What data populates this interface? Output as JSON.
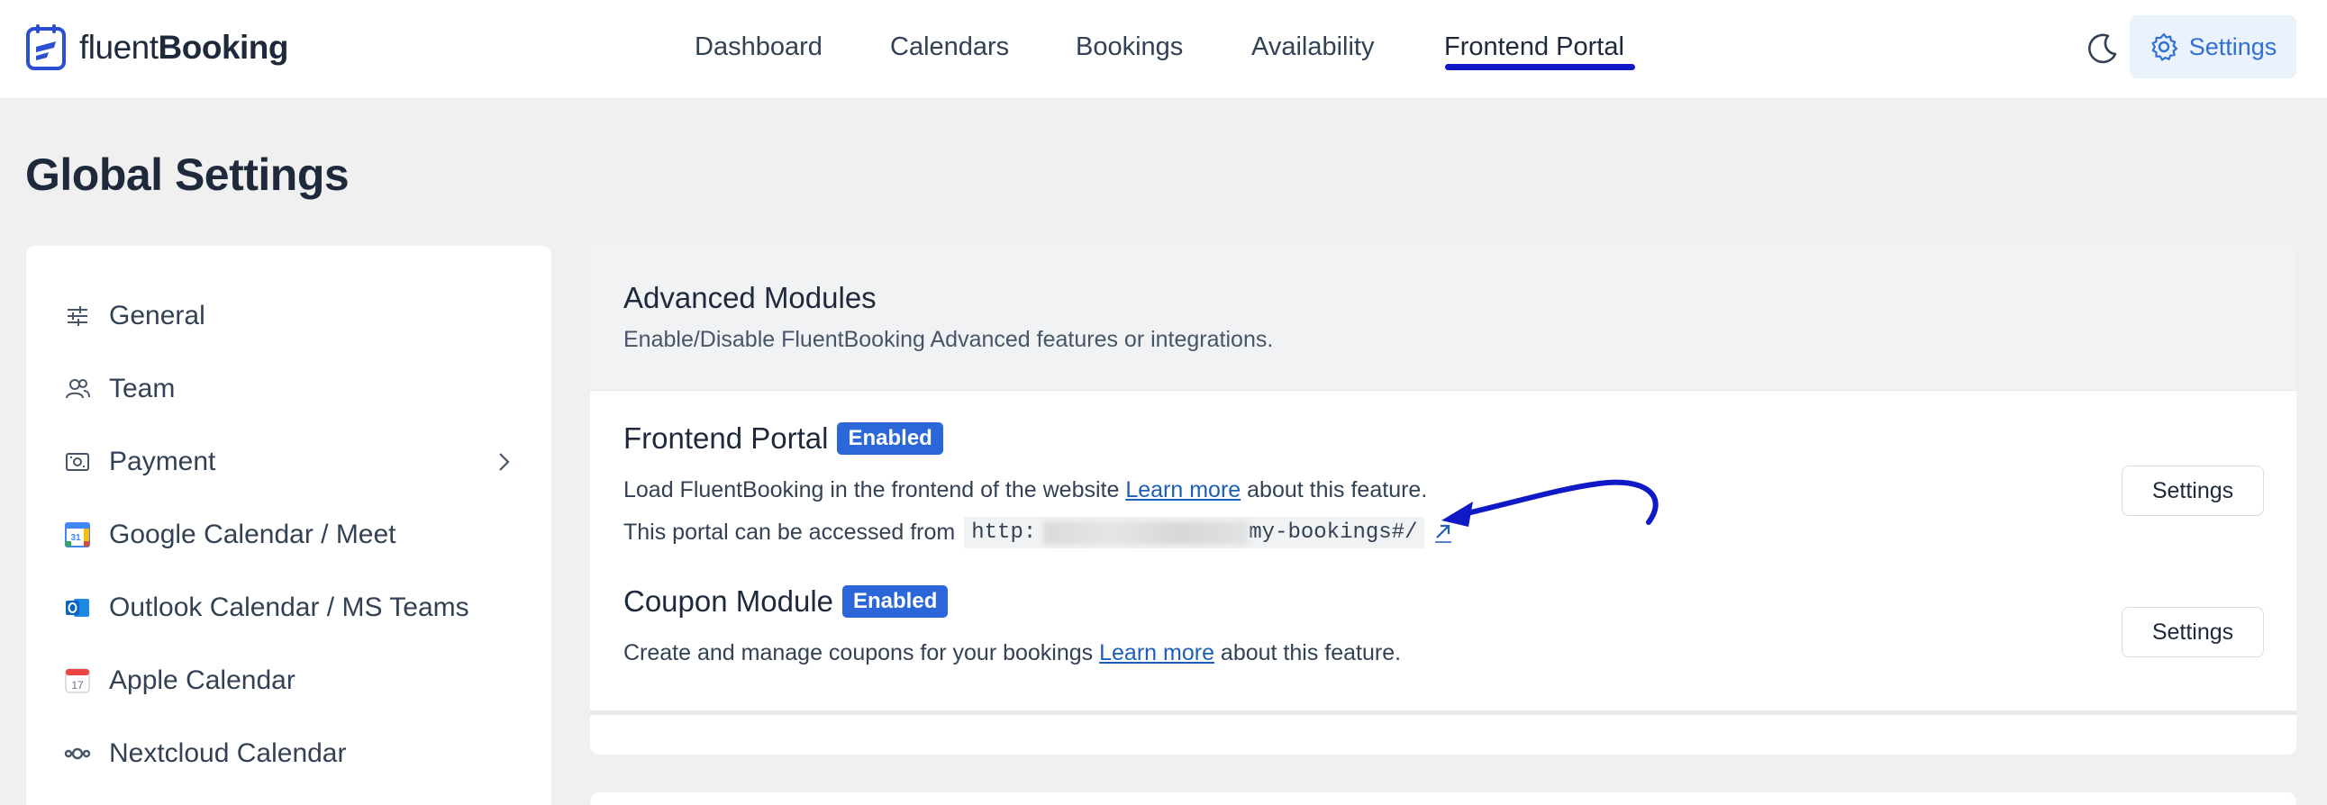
{
  "app": {
    "brand_light": "fluent",
    "brand_bold": "Booking"
  },
  "nav": {
    "items": [
      {
        "label": "Dashboard"
      },
      {
        "label": "Calendars"
      },
      {
        "label": "Bookings"
      },
      {
        "label": "Availability"
      },
      {
        "label": "Frontend Portal",
        "active": true
      }
    ],
    "settings_label": "Settings",
    "theme_icon": "moon-icon"
  },
  "page": {
    "title": "Global Settings"
  },
  "sidebar": {
    "items": [
      {
        "label": "General",
        "icon": "sliders-icon"
      },
      {
        "label": "Team",
        "icon": "team-icon"
      },
      {
        "label": "Payment",
        "icon": "payment-icon",
        "has_submenu": true
      },
      {
        "label": "Google Calendar / Meet",
        "icon": "google-calendar-icon"
      },
      {
        "label": "Outlook Calendar / MS Teams",
        "icon": "outlook-icon"
      },
      {
        "label": "Apple Calendar",
        "icon": "apple-calendar-icon"
      },
      {
        "label": "Nextcloud Calendar",
        "icon": "nextcloud-icon"
      }
    ]
  },
  "main": {
    "title": "Advanced Modules",
    "subtitle": "Enable/Disable FluentBooking Advanced features or integrations.",
    "modules": [
      {
        "title": "Frontend Portal",
        "badge": "Enabled",
        "desc_before": "Load FluentBooking in the frontend of the website ",
        "link": "Learn more",
        "desc_after": " about this feature.",
        "access_label": "This portal can be accessed from",
        "url_start": "http:",
        "url_end": "my-bookings#/",
        "settings_label": "Settings"
      },
      {
        "title": "Coupon Module",
        "badge": "Enabled",
        "desc_before": "Create and manage coupons for your bookings ",
        "link": "Learn more",
        "desc_after": " about this feature.",
        "settings_label": "Settings"
      }
    ]
  },
  "colors": {
    "accent": "#1019c6",
    "badge": "#2b67d9",
    "link": "#1d5fb6",
    "annotation_arrow": "#1019c6"
  }
}
